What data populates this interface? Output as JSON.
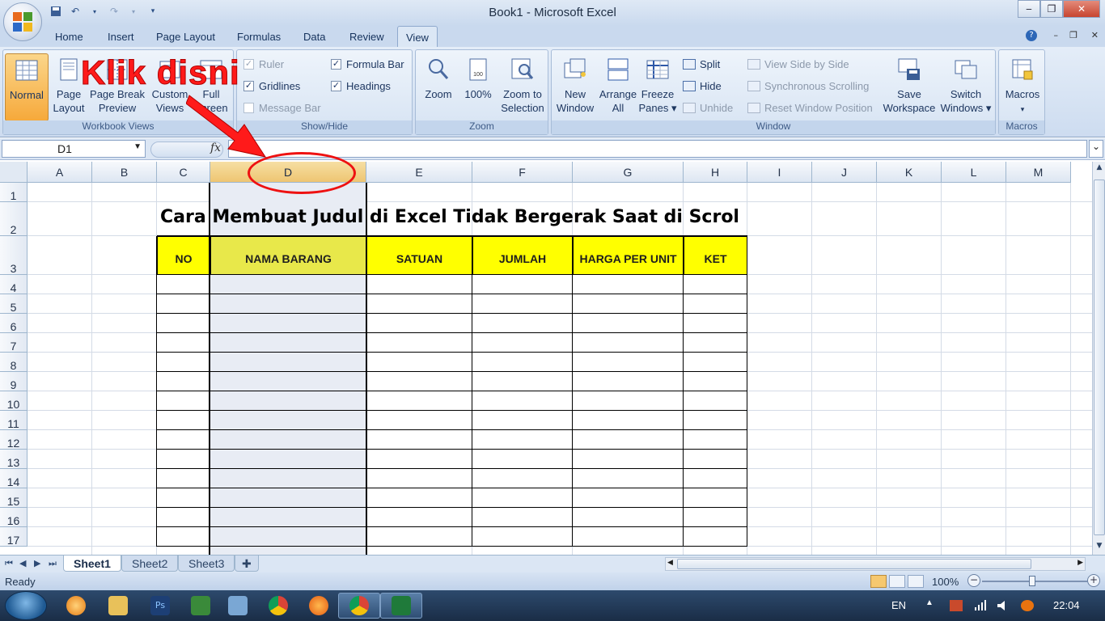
{
  "window": {
    "title": "Book1 - Microsoft Excel"
  },
  "ribbon_tabs": [
    "Home",
    "Insert",
    "Page Layout",
    "Formulas",
    "Data",
    "Review",
    "View"
  ],
  "active_tab": "View",
  "groups": {
    "workbook_views": {
      "label": "Workbook Views",
      "normal": "Normal",
      "page_layout_1": "Page",
      "page_layout_2": "Layout",
      "page_break_1": "Page Break",
      "page_break_2": "Preview",
      "custom_views_1": "Custom",
      "custom_views_2": "Views",
      "full_screen_1": "Full",
      "full_screen_2": "Screen"
    },
    "show_hide": {
      "label": "Show/Hide",
      "ruler": "Ruler",
      "gridlines": "Gridlines",
      "message_bar": "Message Bar",
      "formula_bar": "Formula Bar",
      "headings": "Headings"
    },
    "zoom": {
      "label": "Zoom",
      "zoom": "Zoom",
      "hundred": "100%",
      "zoom_sel_1": "Zoom to",
      "zoom_sel_2": "Selection"
    },
    "window": {
      "label": "Window",
      "new_1": "New",
      "new_2": "Window",
      "arrange_1": "Arrange",
      "arrange_2": "All",
      "freeze_1": "Freeze",
      "freeze_2": "Panes ▾",
      "split": "Split",
      "hide": "Hide",
      "unhide": "Unhide",
      "side_by_side": "View Side by Side",
      "sync_scroll": "Synchronous Scrolling",
      "reset_pos": "Reset Window Position",
      "save_ws_1": "Save",
      "save_ws_2": "Workspace",
      "switch_1": "Switch",
      "switch_2": "Windows ▾"
    },
    "macros": {
      "label": "Macros",
      "macros": "Macros"
    }
  },
  "formula_bar": {
    "name_box": "D1",
    "fx": "fx",
    "value": ""
  },
  "columns": [
    "A",
    "B",
    "C",
    "D",
    "E",
    "F",
    "G",
    "H",
    "I",
    "J",
    "K",
    "L",
    "M"
  ],
  "rows": [
    "1",
    "2",
    "3",
    "4",
    "5",
    "6",
    "7",
    "8",
    "9",
    "10",
    "11",
    "12",
    "13",
    "14",
    "15",
    "16",
    "17"
  ],
  "sheet": {
    "title_row2": "Cara Membuat Judul di Excel Tidak Bergerak Saat di Scrol",
    "table_headers": [
      "NO",
      "NAMA BARANG",
      "SATUAN",
      "JUMLAH",
      "HARGA PER UNIT",
      "KET"
    ]
  },
  "sheet_tabs": [
    "Sheet1",
    "Sheet2",
    "Sheet3"
  ],
  "status": {
    "ready": "Ready",
    "zoom": "100%"
  },
  "taskbar": {
    "lang": "EN",
    "time": "22:04"
  },
  "annotation": {
    "text": "Klik disni"
  },
  "colors": {
    "header_fill": "#ffff00",
    "annotation_red": "#ff1a1a",
    "selected_column": "#e8ecf4"
  }
}
